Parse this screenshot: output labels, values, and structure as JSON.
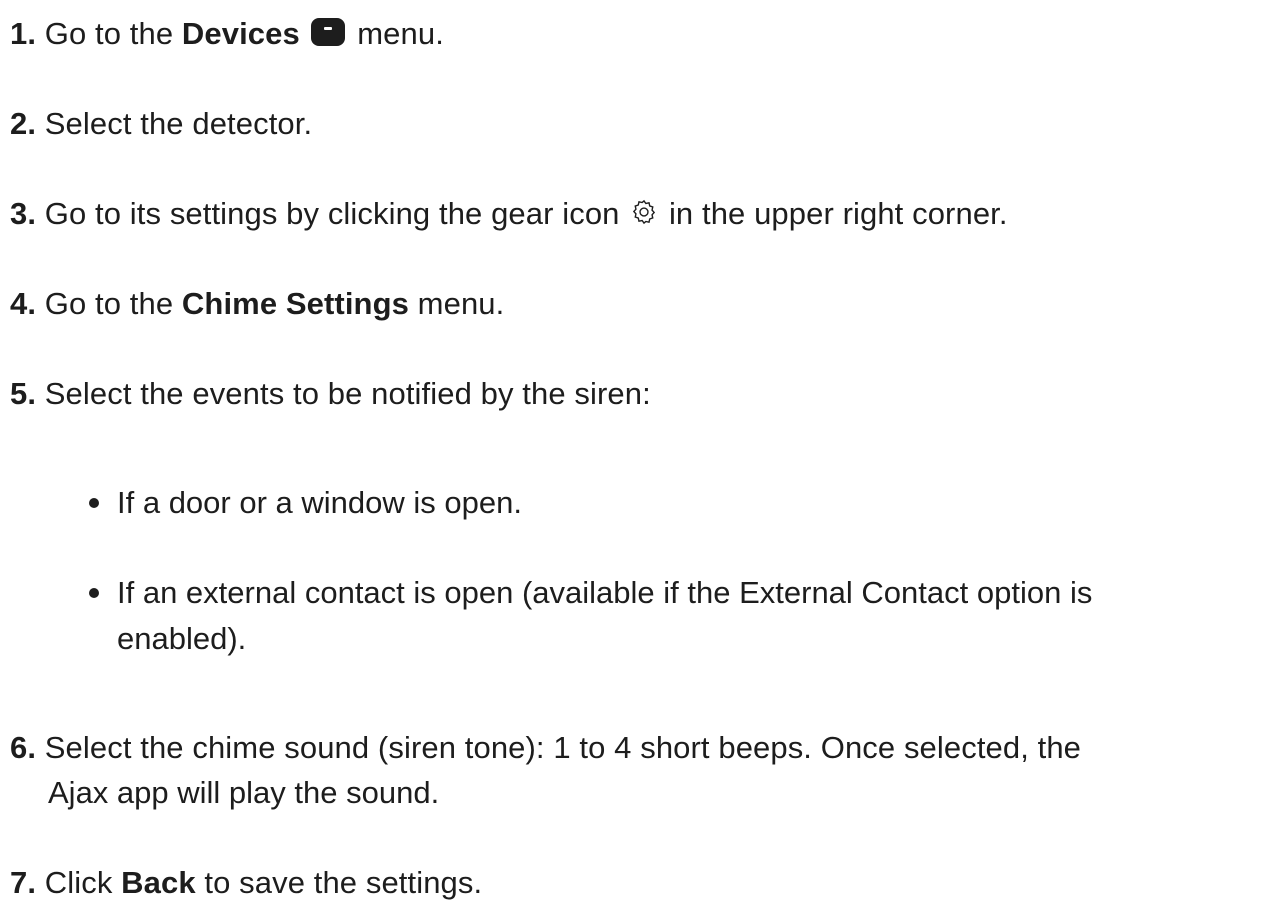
{
  "steps": [
    {
      "num": "1.",
      "pre": " Go to the ",
      "bold": "Devices",
      "icon": "devices-icon",
      "post": " menu."
    },
    {
      "num": "2.",
      "text": " Select the detector."
    },
    {
      "num": "3.",
      "pre": " Go to its settings by clicking the gear icon ",
      "icon": "gear-icon",
      "post": " in the upper right corner."
    },
    {
      "num": "4.",
      "pre": " Go to the ",
      "bold": "Chime Settings",
      "post": " menu."
    },
    {
      "num": "5.",
      "text": " Select the events to be notified by the siren:"
    },
    {
      "num": "6.",
      "text": " Select the chime sound (siren tone): 1 to 4 short beeps. Once selected, the",
      "cont": "Ajax app will play the sound."
    },
    {
      "num": "7.",
      "pre": " Click ",
      "bold": "Back",
      "post": " to save the settings."
    }
  ],
  "bullets": [
    {
      "text": "If a door or a window is open."
    },
    {
      "text": "If an external contact is open (available if the External Contact option is",
      "cont": "enabled)."
    }
  ]
}
